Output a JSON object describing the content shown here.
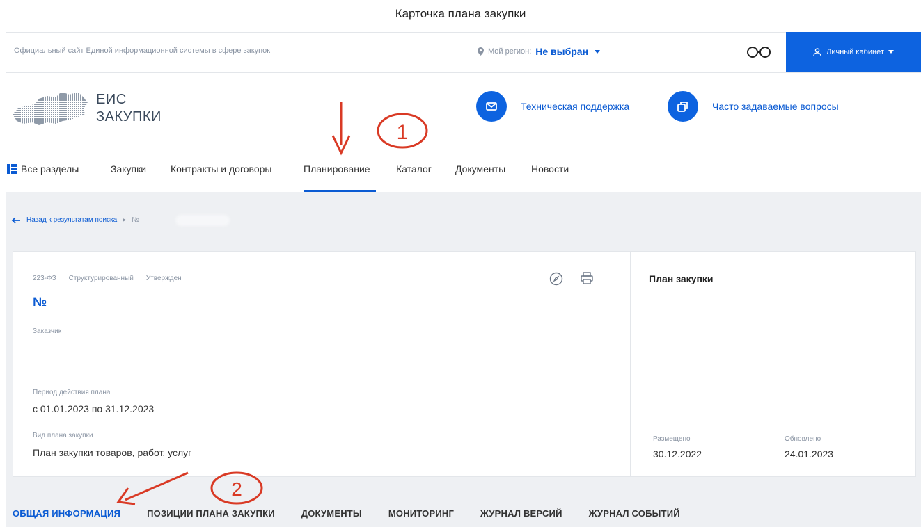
{
  "caption": "Карточка плана закупки",
  "topbar": {
    "site_description": "Официальный сайт Единой информационной системы в сфере закупок",
    "region_label": "Мой регион:",
    "region_value": "Не выбран",
    "cabinet_label": "Личный кабинет"
  },
  "header": {
    "logo_line1": "ЕИС",
    "logo_line2": "ЗАКУПКИ",
    "support_label": "Техническая поддержка",
    "faq_label": "Часто задаваемые вопросы"
  },
  "nav": {
    "items": [
      {
        "label": "Все разделы"
      },
      {
        "label": "Закупки"
      },
      {
        "label": "Контракты и договоры"
      },
      {
        "label": "Планирование"
      },
      {
        "label": "Каталог"
      },
      {
        "label": "Документы"
      },
      {
        "label": "Новости"
      }
    ],
    "active": "Планирование"
  },
  "breadcrumb": {
    "back_label": "Назад к результатам поиска",
    "number_prefix": "№"
  },
  "card": {
    "tags": [
      "223-ФЗ",
      "Структурированный",
      "Утвержден"
    ],
    "number": "№",
    "customer_label": "Заказчик",
    "period_label": "Период действия плана",
    "period_value": "с 01.01.2023 по 31.12.2023",
    "type_label": "Вид плана закупки",
    "type_value": "План закупки товаров, работ, услуг"
  },
  "side": {
    "title": "План закупки",
    "posted_label": "Размещено",
    "posted_value": "30.12.2022",
    "updated_label": "Обновлено",
    "updated_value": "24.01.2023"
  },
  "tabs": [
    {
      "label": "ОБЩАЯ ИНФОРМАЦИЯ"
    },
    {
      "label": "ПОЗИЦИИ ПЛАНА ЗАКУПКИ"
    },
    {
      "label": "ДОКУМЕНТЫ"
    },
    {
      "label": "МОНИТОРИНГ"
    },
    {
      "label": "ЖУРНАЛ ВЕРСИЙ"
    },
    {
      "label": "ЖУРНАЛ СОБЫТИЙ"
    }
  ],
  "annotations": {
    "marker1": "1",
    "marker2": "2"
  },
  "colors": {
    "accent": "#0d63e0",
    "annotation": "#d93a25",
    "panel_bg": "#eef0f3"
  }
}
